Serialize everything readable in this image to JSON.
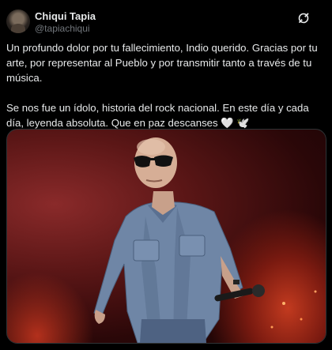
{
  "tweet": {
    "author_name": "Chiqui Tapia",
    "author_handle": "@tapiachiqui",
    "paragraphs": [
      "Un profundo dolor por tu fallecimiento, Indio querido. Gracias por tu arte, por representar al Pueblo y por transmitir tanto a través de tu música.",
      "Se nos fue un ídolo, historia del rock nacional. En este día y cada día, leyenda absoluta. Que en paz descanses 🤍 🕊️"
    ]
  },
  "icons": {
    "header_action": "grok-icon"
  },
  "colors": {
    "background": "#000000",
    "text": "#e7e9ea",
    "secondary_text": "#71767b"
  }
}
